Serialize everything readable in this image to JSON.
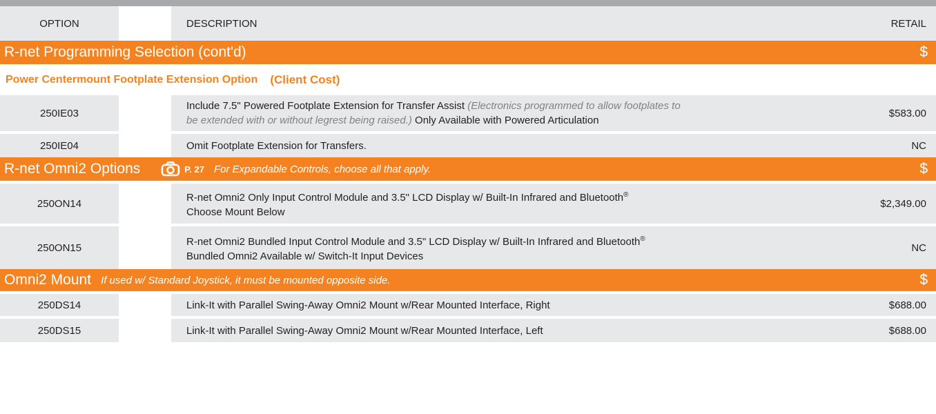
{
  "header": {
    "option": "OPTION",
    "description": "DESCRIPTION",
    "retail": "RETAIL"
  },
  "sections": {
    "programming": {
      "title": "R-net Programming Selection (cont'd)",
      "dollar": "$"
    },
    "footplate": {
      "title": "Power Centermount Footplate Extension Option",
      "cost": "(Client Cost)"
    },
    "omni2": {
      "title": "R-net Omni2 Options",
      "page_ref": "P. 27",
      "note": "For Expandable Controls, choose all that apply.",
      "dollar": "$",
      "icon": "camera-icon"
    },
    "mount": {
      "title": "Omni2 Mount",
      "note": "If used w/ Standard Joystick, it must be mounted opposite side.",
      "dollar": "$"
    }
  },
  "rows": {
    "ie03": {
      "code": "250IE03",
      "desc": "Include 7.5\" Powered Footplate Extension for Transfer Assist ",
      "desc_note": "(Electronics programmed to allow footplates to",
      "desc_note2": "be extended with or without legrest being raised.)",
      "desc_tail": " Only Available with Powered Articulation",
      "price": "$583.00"
    },
    "ie04": {
      "code": "250IE04",
      "desc": "Omit Footplate Extension for Transfers.",
      "price": "NC"
    },
    "on14": {
      "code": "250ON14",
      "desc": "R-net Omni2 Only Input Control Module and 3.5\" LCD Display w/ Built-In Infrared and Bluetooth",
      "reg": "®",
      "desc2": "Choose Mount Below",
      "price": "$2,349.00"
    },
    "on15": {
      "code": "250ON15",
      "desc": "R-net Omni2 Bundled Input Control Module and 3.5\" LCD Display w/ Built-In Infrared and Bluetooth",
      "reg": "®",
      "desc2": "Bundled Omni2 Available w/ Switch-It Input Devices",
      "price": "NC"
    },
    "ds14": {
      "code": "250DS14",
      "desc": "Link-It with Parallel Swing-Away Omni2 Mount w/Rear Mounted Interface, Right",
      "price": "$688.00"
    },
    "ds15": {
      "code": "250DS15",
      "desc": "Link-It with Parallel Swing-Away Omni2 Mount w/Rear Mounted Interface, Left",
      "price": "$688.00"
    }
  },
  "colors": {
    "accent": "#f58220",
    "row_bg": "#e7e8e9",
    "top_bar": "#a7a9ac"
  }
}
